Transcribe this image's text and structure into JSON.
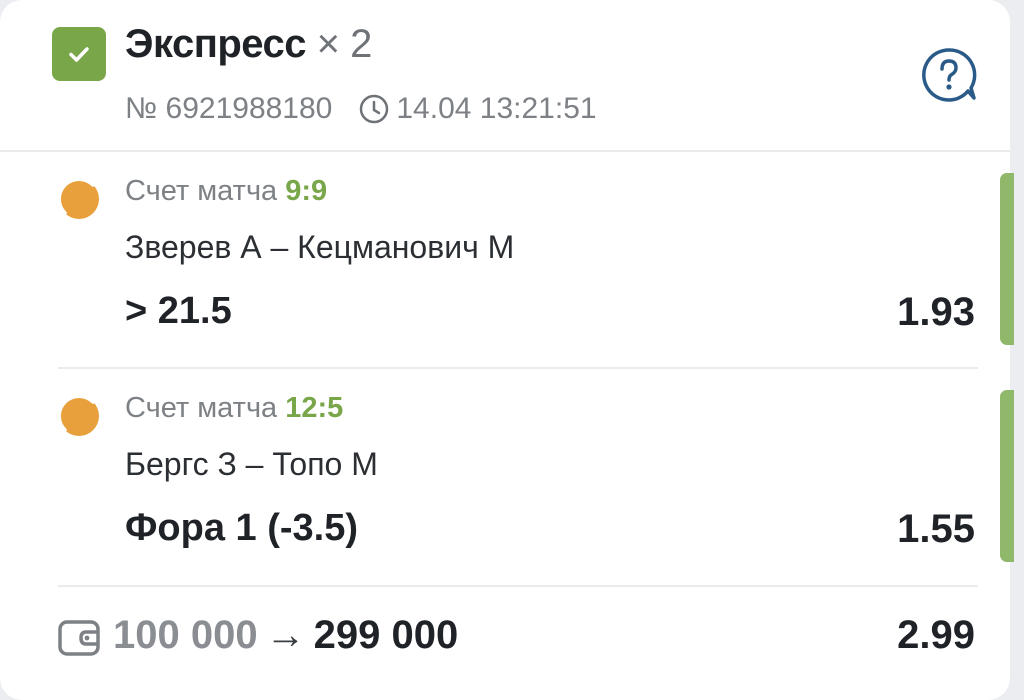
{
  "bet": {
    "type_label": "Экспресс",
    "multiplier_label": "× 2",
    "number_label": "№ 6921988180",
    "datetime": "14.04 13:21:51"
  },
  "events": [
    {
      "score_label": "Счет матча",
      "score": "9:9",
      "teams": "Зверев А – Кецманович М",
      "outcome": "> 21.5",
      "odds": "1.93"
    },
    {
      "score_label": "Счет матча",
      "score": "12:5",
      "teams": "Бергс З – Топо М",
      "outcome": "Фора 1 (-3.5)",
      "odds": "1.55"
    }
  ],
  "summary": {
    "stake": "100 000",
    "arrow": "→",
    "payout": "299 000",
    "total_odds": "2.99"
  },
  "icons": {
    "status": "check-icon",
    "help": "help-icon",
    "clock": "clock-icon",
    "sport": "tennis-ball-icon",
    "wallet": "wallet-icon"
  },
  "colors": {
    "accent_green": "#7aa64a",
    "sport_orange": "#e8a03c",
    "help_blue": "#2a5a87"
  }
}
